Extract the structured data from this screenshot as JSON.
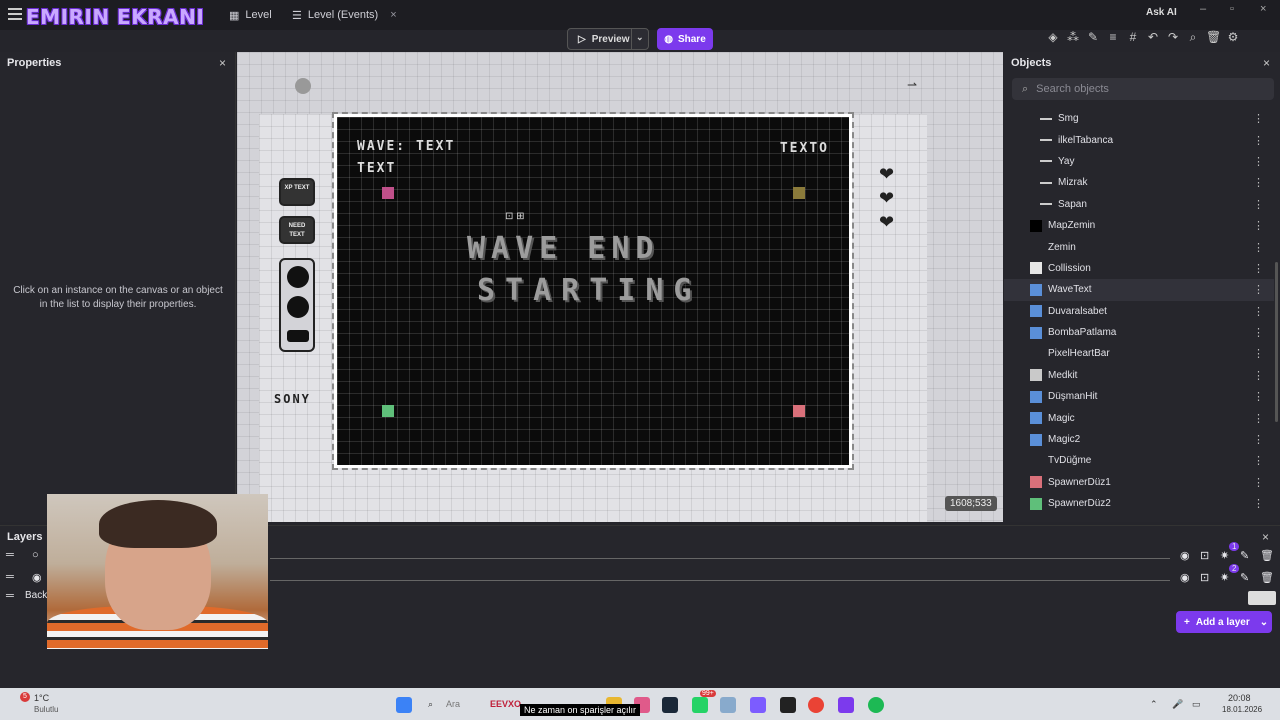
{
  "stream": {
    "overlay_title": "EMIRIN EKRANI"
  },
  "tabs": [
    {
      "label": "Level"
    },
    {
      "label": "Level (Events)"
    }
  ],
  "header": {
    "ask_ai": "Ask AI"
  },
  "toolbar": {
    "preview_label": "Preview",
    "share_label": "Share"
  },
  "properties": {
    "title": "Properties",
    "empty_message": "Click on an instance on the canvas or an object in the list to display their properties."
  },
  "canvas": {
    "wave_text": "WAVE: TEXT",
    "text_label": "TEXT",
    "texto_label": "TEXTO",
    "wave_end": "WAVE END",
    "starting": "STARTING",
    "chip_xp": "XP TEXT",
    "chip_need": "NEED TEXT",
    "sony": "SONY",
    "coords": "1608;533"
  },
  "objects": {
    "title": "Objects",
    "search_placeholder": "Search objects",
    "items": [
      {
        "label": "Smg",
        "icon": "gun-icon",
        "indent": true,
        "color": "#cccccc"
      },
      {
        "label": "ilkelTabanca",
        "icon": "pistol-icon",
        "indent": true,
        "color": "#cccccc"
      },
      {
        "label": "Yay",
        "icon": "bow-icon",
        "indent": true,
        "color": "#cccccc"
      },
      {
        "label": "Mizrak",
        "icon": "spear-icon",
        "indent": true,
        "color": "#cccccc"
      },
      {
        "label": "Sapan",
        "icon": "slingshot-icon",
        "indent": true,
        "color": "#cccccc"
      },
      {
        "label": "MapZemin",
        "icon": "black-square-icon",
        "indent": false,
        "color": "#000000"
      },
      {
        "label": "Zemin",
        "icon": "empty-icon",
        "indent": false,
        "color": "transparent"
      },
      {
        "label": "Collission",
        "icon": "white-square-icon",
        "indent": false,
        "color": "#e6e6e6"
      },
      {
        "label": "WaveText",
        "icon": "text-object-icon",
        "indent": false,
        "color": "#5a8fd8"
      },
      {
        "label": "Duvaralsabet",
        "icon": "particle-icon",
        "indent": false,
        "color": "#5a8fd8"
      },
      {
        "label": "BombaPatlama",
        "icon": "particle-icon",
        "indent": false,
        "color": "#5a8fd8"
      },
      {
        "label": "PixelHeartBar",
        "icon": "empty-icon",
        "indent": false,
        "color": "transparent"
      },
      {
        "label": "Medkit",
        "icon": "medkit-icon",
        "indent": false,
        "color": "#c9c9c9"
      },
      {
        "label": "DüşmanHit",
        "icon": "particle-icon",
        "indent": false,
        "color": "#5a8fd8"
      },
      {
        "label": "Magic",
        "icon": "particle-icon",
        "indent": false,
        "color": "#5a8fd8"
      },
      {
        "label": "Magic2",
        "icon": "particle-icon",
        "indent": false,
        "color": "#5a8fd8"
      },
      {
        "label": "TvDüğme",
        "icon": "empty-icon",
        "indent": false,
        "color": "transparent"
      },
      {
        "label": "SpawnerDüz1",
        "icon": "pink-square-icon",
        "indent": false,
        "color": "#d9707a"
      },
      {
        "label": "SpawnerDüz2",
        "icon": "green-square-icon",
        "indent": false,
        "color": "#5fbf7a"
      }
    ]
  },
  "layers": {
    "title": "Layers",
    "background_label": "Back",
    "add_label": "Add a layer",
    "badge1": "1",
    "badge2": "2"
  },
  "taskbar": {
    "weather_temp": "1°C",
    "weather_desc": "Bulutlu",
    "search_label": "Ara",
    "brand": "EEVXO",
    "ticker": "Ne zaman on sparişler açılır",
    "time": "20:08",
    "date": "18.01.2026",
    "notification_count": "5",
    "app_badge": "99+"
  }
}
